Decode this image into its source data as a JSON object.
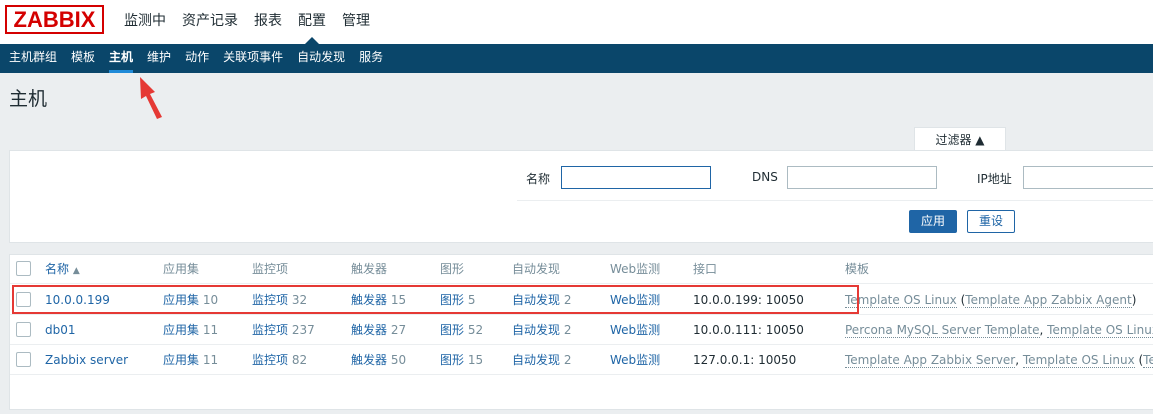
{
  "logo": "ZABBIX",
  "main_nav": [
    "监测中",
    "资产记录",
    "报表",
    "配置",
    "管理"
  ],
  "sub_nav": [
    "主机群组",
    "模板",
    "主机",
    "维护",
    "动作",
    "关联项事件",
    "自动发现",
    "服务"
  ],
  "page_title": "主机",
  "filter": {
    "tab_label": "过滤器 ▲",
    "name_label": "名称",
    "name_value": "",
    "dns_label": "DNS",
    "dns_value": "",
    "ip_label": "IP地址",
    "ip_value": "",
    "apply_label": "应用",
    "reset_label": "重设"
  },
  "table": {
    "headers": {
      "name": "名称",
      "sort": "▲",
      "apps": "应用集",
      "items": "监控项",
      "triggers": "触发器",
      "graphs": "图形",
      "discovery": "自动发现",
      "web": "Web监测",
      "interface": "接口",
      "templates": "模板"
    },
    "rows": [
      {
        "name": "10.0.0.199",
        "apps_label": "应用集",
        "apps_count": "10",
        "items_label": "监控项",
        "items_count": "32",
        "triggers_label": "触发器",
        "triggers_count": "15",
        "graphs_label": "图形",
        "graphs_count": "5",
        "discovery_label": "自动发现",
        "discovery_count": "2",
        "web_label": "Web监测",
        "interface": "10.0.0.199: 10050",
        "template_1": "Template OS Linux",
        "template_2": "Template App Zabbix Agent"
      },
      {
        "name": "db01",
        "apps_label": "应用集",
        "apps_count": "11",
        "items_label": "监控项",
        "items_count": "237",
        "triggers_label": "触发器",
        "triggers_count": "27",
        "graphs_label": "图形",
        "graphs_count": "52",
        "discovery_label": "自动发现",
        "discovery_count": "2",
        "web_label": "Web监测",
        "interface": "10.0.0.111: 10050",
        "template_1": "Percona MySQL Server Template",
        "template_2": "Template OS Linux",
        "template_3": "Te"
      },
      {
        "name": "Zabbix server",
        "apps_label": "应用集",
        "apps_count": "11",
        "items_label": "监控项",
        "items_count": "82",
        "triggers_label": "触发器",
        "triggers_count": "50",
        "graphs_label": "图形",
        "graphs_count": "15",
        "discovery_label": "自动发现",
        "discovery_count": "2",
        "web_label": "Web监测",
        "interface": "127.0.0.1: 10050",
        "template_1": "Template App Zabbix Server",
        "template_2": "Template OS Linux",
        "template_3": "Templat"
      }
    ]
  },
  "colors": {
    "nav_dark": "#0a466a",
    "link": "#1f65a6",
    "highlight": "#e53935",
    "logo": "#d40000"
  }
}
